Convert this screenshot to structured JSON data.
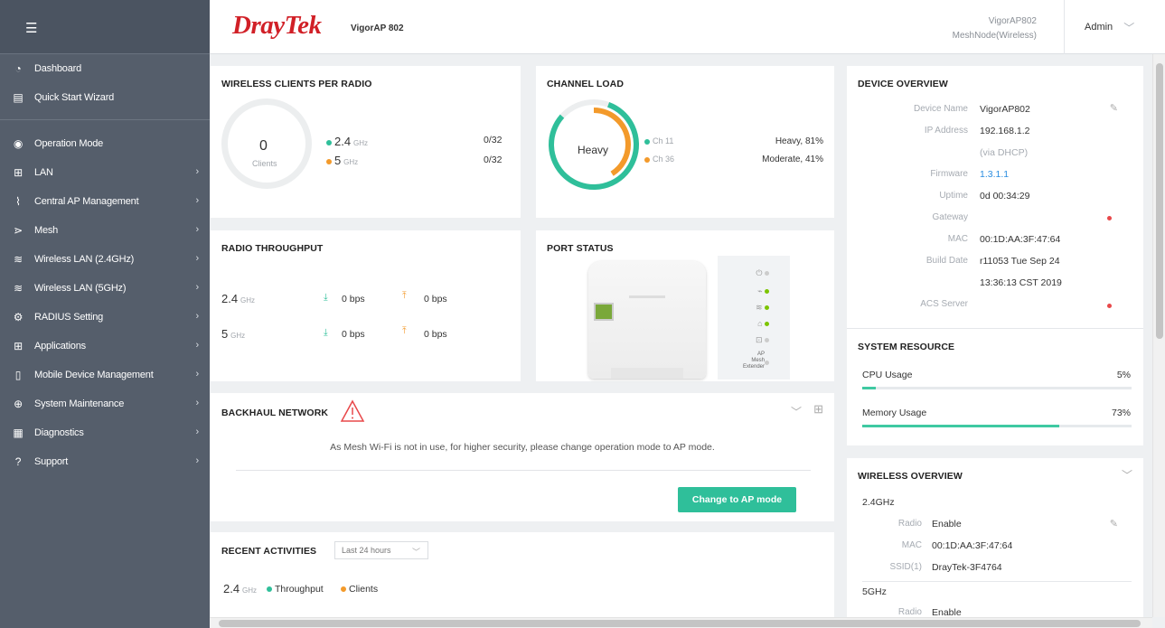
{
  "sidebar": {
    "items": [
      {
        "label": "Dashboard",
        "icon": "dashboard-icon",
        "glyph": "◔",
        "arrow": false
      },
      {
        "label": "Quick Start Wizard",
        "icon": "wizard-icon",
        "glyph": "▤",
        "arrow": false
      },
      {
        "label": "Operation Mode",
        "icon": "operation-mode-icon",
        "glyph": "◉",
        "arrow": false
      },
      {
        "label": "LAN",
        "icon": "lan-icon",
        "glyph": "⊞",
        "arrow": true
      },
      {
        "label": "Central AP Management",
        "icon": "central-ap-icon",
        "glyph": "⌇",
        "arrow": true
      },
      {
        "label": "Mesh",
        "icon": "mesh-icon",
        "glyph": "⋗",
        "arrow": true
      },
      {
        "label": "Wireless LAN (2.4GHz)",
        "icon": "wifi-icon",
        "glyph": "≋",
        "arrow": true
      },
      {
        "label": "Wireless LAN (5GHz)",
        "icon": "wifi-icon",
        "glyph": "≋",
        "arrow": true
      },
      {
        "label": "RADIUS Setting",
        "icon": "gear-icon",
        "glyph": "⚙",
        "arrow": true
      },
      {
        "label": "Applications",
        "icon": "applications-icon",
        "glyph": "⊞",
        "arrow": true
      },
      {
        "label": "Mobile Device Management",
        "icon": "mobile-icon",
        "glyph": "▯",
        "arrow": true
      },
      {
        "label": "System Maintenance",
        "icon": "maintenance-icon",
        "glyph": "⊕",
        "arrow": true
      },
      {
        "label": "Diagnostics",
        "icon": "diagnostics-icon",
        "glyph": "▦",
        "arrow": true
      },
      {
        "label": "Support",
        "icon": "support-icon",
        "glyph": "?",
        "arrow": true
      }
    ]
  },
  "header": {
    "brand_a": "Dray",
    "brand_b": "Tek",
    "model": "VigorAP 802",
    "device": "VigorAP802",
    "node": "MeshNode(Wireless)",
    "user": "Admin"
  },
  "clients": {
    "title": "WIRELESS CLIENTS PER RADIO",
    "count": "0",
    "count_label": "Clients",
    "b24": "2.4",
    "b5": "5",
    "unit": "GHz",
    "v24": "0",
    "v5": "0",
    "max": "/32"
  },
  "channel": {
    "title": "CHANNEL LOAD",
    "state": "Heavy",
    "ch1": "Ch 11",
    "ch2": "Ch 36",
    "v1": "Heavy, 81%",
    "v2": "Moderate, 41%"
  },
  "overview": {
    "title": "DEVICE OVERVIEW",
    "rows": [
      {
        "label": "Device Name",
        "value": "VigorAP802"
      },
      {
        "label": "IP Address",
        "value": "192.168.1.2"
      },
      {
        "label": "",
        "value": "(via DHCP)"
      },
      {
        "label": "Firmware",
        "value": "1.3.1.1"
      },
      {
        "label": "Uptime",
        "value": "0d 00:34:29"
      },
      {
        "label": "Gateway",
        "value": ""
      },
      {
        "label": "MAC",
        "value": "00:1D:AA:3F:47:64"
      },
      {
        "label": "Build Date",
        "value": "r11053 Tue Sep 24"
      },
      {
        "label": "",
        "value": "13:36:13 CST 2019"
      },
      {
        "label": "ACS Server",
        "value": ""
      }
    ]
  },
  "throughput": {
    "title": "RADIO THROUGHPUT",
    "r1": "2.4",
    "r2": "5",
    "unit": "GHz",
    "down1": "0 bps",
    "up1": "0 bps",
    "down2": "0 bps",
    "up2": "0 bps"
  },
  "port": {
    "title": "PORT STATUS",
    "ap": "AP",
    "mesh": "Mesh",
    "ext": "Extender"
  },
  "resource": {
    "title": "SYSTEM RESOURCE",
    "cpu_label": "CPU Usage",
    "cpu": "5%",
    "cpu_frac": 0.05,
    "mem_label": "Memory Usage",
    "mem": "73%",
    "mem_frac": 0.73
  },
  "backhaul": {
    "title": "BACKHAUL NETWORK",
    "message": "As Mesh Wi-Fi is not in use, for higher security, please change operation mode to AP mode.",
    "button": "Change to AP mode"
  },
  "wireless": {
    "title": "WIRELESS OVERVIEW",
    "band1": "2.4GHz",
    "radio_label": "Radio",
    "radio": "Enable",
    "mac_label": "MAC",
    "mac": "00:1D:AA:3F:47:64",
    "ssid_label": "SSID(1)",
    "ssid": "DrayTek-3F4764",
    "band2": "5GHz",
    "radio2": "Enable"
  },
  "recent": {
    "title": "RECENT ACTIVITIES",
    "range": "Last 24 hours",
    "band": "2.4",
    "unit": "GHz",
    "l1": "Throughput",
    "l2": "Clients"
  },
  "colors": {
    "teal": "#2fbf9a",
    "orange": "#f39a2b",
    "red": "#e8484a",
    "green": "#7cc400"
  }
}
